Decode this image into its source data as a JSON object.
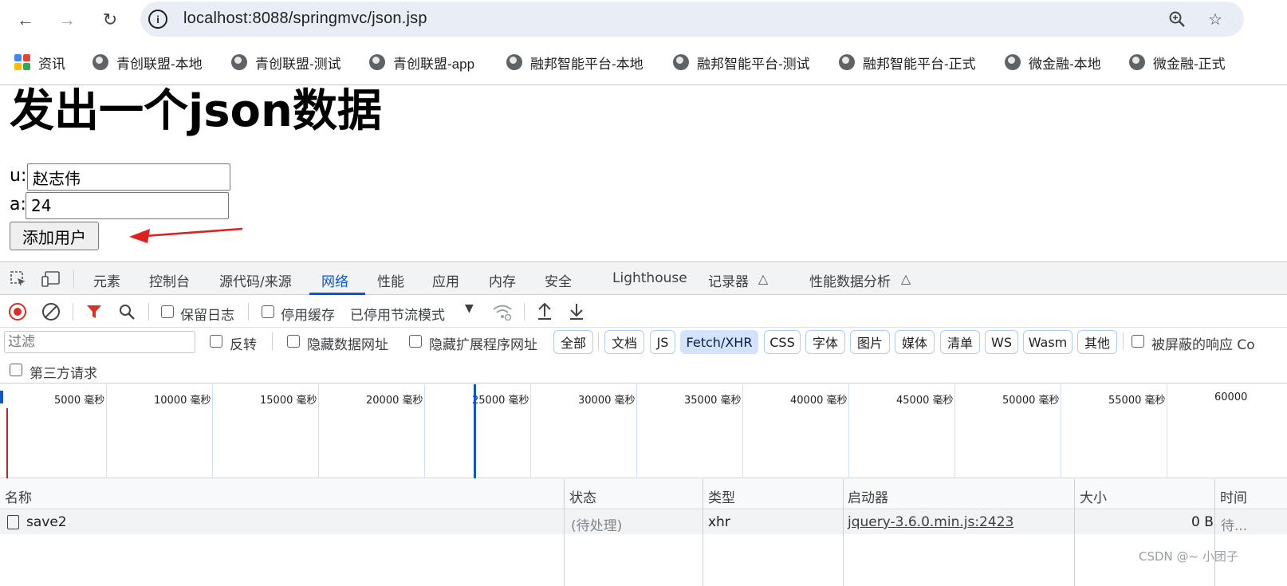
{
  "browser": {
    "url": "localhost:8088/springmvc/json.jsp",
    "nav_icons": [
      "back-icon",
      "forward-icon",
      "reload-icon"
    ],
    "omnibox_icons": [
      "site-info-icon",
      "zoom-icon",
      "bookmark-star-icon"
    ]
  },
  "bookmarks": [
    {
      "label": "资讯",
      "icon": "google-apps-icon"
    },
    {
      "label": "青创联盟-本地",
      "icon": "globe-icon"
    },
    {
      "label": "青创联盟-测试",
      "icon": "globe-icon"
    },
    {
      "label": "青创联盟-app",
      "icon": "globe-icon"
    },
    {
      "label": "融邦智能平台-本地",
      "icon": "globe-icon"
    },
    {
      "label": "融邦智能平台-测试",
      "icon": "globe-icon"
    },
    {
      "label": "融邦智能平台-正式",
      "icon": "globe-icon"
    },
    {
      "label": "微金融-本地",
      "icon": "globe-icon"
    },
    {
      "label": "微金融-正式",
      "icon": "globe-icon"
    }
  ],
  "page": {
    "heading": "发出一个json数据",
    "user_label": "u:",
    "user_value": "赵志伟",
    "age_label": "a:",
    "age_value": "24",
    "add_button": "添加用户",
    "annotation_color": "#e0201f"
  },
  "devtools": {
    "tabs": [
      "元素",
      "控制台",
      "源代码/来源",
      "网络",
      "性能",
      "应用",
      "内存",
      "安全",
      "Lighthouse",
      "记录器",
      "性能数据分析"
    ],
    "active_tab": "网络",
    "toolbar": {
      "preserve_log": "保留日志",
      "disable_cache": "停用缓存",
      "throttling": "已停用节流模式"
    },
    "filter": {
      "placeholder": "过滤",
      "invert": "反转",
      "hide_data_urls": "隐藏数据网址",
      "hide_extension_urls": "隐藏扩展程序网址",
      "types": [
        "全部",
        "文档",
        "JS",
        "Fetch/XHR",
        "CSS",
        "字体",
        "图片",
        "媒体",
        "清单",
        "WS",
        "Wasm",
        "其他"
      ],
      "selected_type": "Fetch/XHR",
      "blocked_responses": "被屏蔽的响应 Co",
      "third_party": "第三方请求"
    },
    "timeline": {
      "ticks": [
        "5000 毫秒",
        "10000 毫秒",
        "15000 毫秒",
        "20000 毫秒",
        "25000 毫秒",
        "30000 毫秒",
        "35000 毫秒",
        "40000 毫秒",
        "45000 毫秒",
        "50000 毫秒",
        "55000 毫秒",
        "60000"
      ]
    },
    "table": {
      "headers": [
        "名称",
        "状态",
        "类型",
        "启动器",
        "大小",
        "时间"
      ],
      "rows": [
        {
          "name": "save2",
          "status": "(待处理)",
          "type": "xhr",
          "initiator": "jquery-3.6.0.min.js:2423",
          "size": "0 B",
          "time": "待..."
        }
      ]
    }
  },
  "watermark": "CSDN @~ 小团子",
  "colors": {
    "accent": "#0b57d0",
    "record": "#c5221f",
    "filter_active": "#d93025"
  }
}
